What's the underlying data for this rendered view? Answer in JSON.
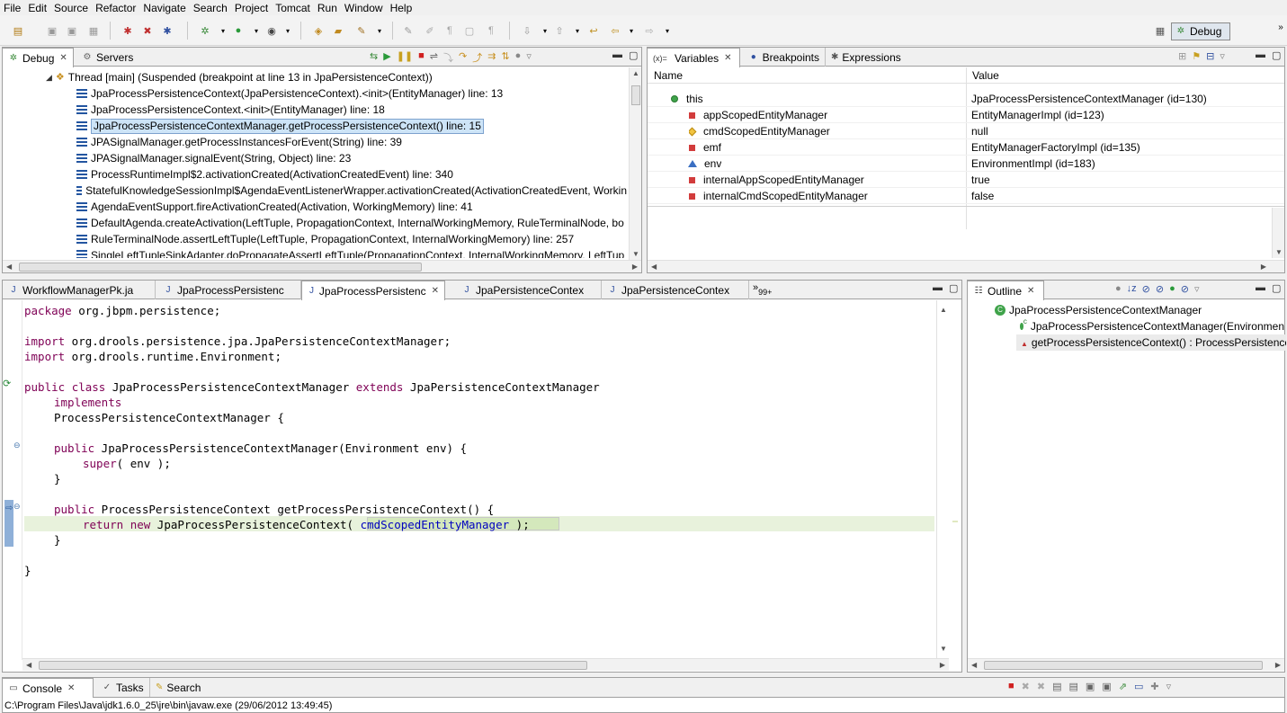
{
  "menu": [
    "File",
    "Edit",
    "Source",
    "Refactor",
    "Navigate",
    "Search",
    "Project",
    "Tomcat",
    "Run",
    "Window",
    "Help"
  ],
  "perspective": {
    "label": "Debug"
  },
  "debug_view": {
    "tabs": [
      {
        "label": "Debug",
        "active": true
      },
      {
        "label": "Servers",
        "active": false
      }
    ],
    "thread": "Thread [main] (Suspended (breakpoint at line 13 in JpaPersistenceContext))",
    "frames": [
      "JpaProcessPersistenceContext(JpaPersistenceContext).<init>(EntityManager) line: 13",
      "JpaProcessPersistenceContext.<init>(EntityManager) line: 18",
      "JpaProcessPersistenceContextManager.getProcessPersistenceContext() line: 15",
      "JPASignalManager.getProcessInstancesForEvent(String) line: 39",
      "JPASignalManager.signalEvent(String, Object) line: 23",
      "ProcessRuntimeImpl$2.activationCreated(ActivationCreatedEvent) line: 340",
      "StatefulKnowledgeSessionImpl$AgendaEventListenerWrapper.activationCreated(ActivationCreatedEvent, Workin",
      "AgendaEventSupport.fireActivationCreated(Activation, WorkingMemory) line: 41",
      "DefaultAgenda.createActivation(LeftTuple, PropagationContext, InternalWorkingMemory, RuleTerminalNode, bo",
      "RuleTerminalNode.assertLeftTuple(LeftTuple, PropagationContext, InternalWorkingMemory) line: 257",
      "SingleLeftTupleSinkAdapter.doPropagateAssertLeftTuple(PropagationContext, InternalWorkingMemory, LeftTup"
    ],
    "selected_frame": 2
  },
  "variables_view": {
    "tabs": [
      {
        "label": "Variables",
        "active": true
      },
      {
        "label": "Breakpoints",
        "active": false
      },
      {
        "label": "Expressions",
        "active": false
      }
    ],
    "columns": [
      "Name",
      "Value"
    ],
    "rows": [
      {
        "name": "this",
        "value": "JpaProcessPersistenceContextManager  (id=130)",
        "icon": "object-icon"
      },
      {
        "name": "appScopedEntityManager",
        "value": "EntityManagerImpl  (id=123)",
        "icon": "private-field-icon"
      },
      {
        "name": "cmdScopedEntityManager",
        "value": "null",
        "icon": "protected-field-icon"
      },
      {
        "name": "emf",
        "value": "EntityManagerFactoryImpl  (id=135)",
        "icon": "private-field-icon"
      },
      {
        "name": "env",
        "value": "EnvironmentImpl  (id=183)",
        "icon": "package-field-icon"
      },
      {
        "name": "internalAppScopedEntityManager",
        "value": "true",
        "icon": "private-field-icon"
      },
      {
        "name": "internalCmdScopedEntityManager",
        "value": "false",
        "icon": "private-field-icon"
      }
    ]
  },
  "editor": {
    "tabs": [
      {
        "label": "WorkflowManagerPk.ja",
        "active": false
      },
      {
        "label": "JpaProcessPersistenc",
        "active": false
      },
      {
        "label": "JpaProcessPersistenc",
        "active": true
      },
      {
        "label": "JpaPersistenceContex",
        "active": false
      },
      {
        "label": "JpaPersistenceContex",
        "active": false
      }
    ],
    "overflow": "99+",
    "code": {
      "l1_kw": "package",
      "l1_rest": " org.jbpm.persistence;",
      "l2_kw": "import",
      "l2_rest": " org.drools.persistence.jpa.JpaPersistenceContextManager;",
      "l3_kw": "import",
      "l3_rest": " org.drools.runtime.Environment;",
      "l4_kw1": "public",
      "l4_kw2": "class",
      "l4_name": " JpaProcessPersistenceContextManager ",
      "l4_kw3": "extends",
      "l4_rest": " JpaPersistenceContextManager",
      "l5_kw": "implements",
      "l6": "ProcessPersistenceContextManager {",
      "l7_kw": "public",
      "l7_rest": " JpaProcessPersistenceContextManager(Environment env) {",
      "l8_kw": "super",
      "l8_rest": "( env );",
      "l9": "}",
      "l10_kw": "public",
      "l10_rest": " ProcessPersistenceContext getProcessPersistenceContext() {",
      "l11_kw1": "return",
      "l11_kw2": "new",
      "l11_mid": " JpaProcessPersistenceContext( ",
      "l11_fld": "cmdScopedEntityManager",
      "l11_end": " );",
      "l12": "}",
      "l13": "}"
    }
  },
  "outline": {
    "tab": "Outline",
    "items": [
      "JpaProcessPersistenceContextManager",
      "JpaProcessPersistenceContextManager(Environmen",
      "getProcessPersistenceContext() : ProcessPersistence"
    ],
    "constructor_badge": "c"
  },
  "console": {
    "tabs": [
      {
        "label": "Console",
        "active": true
      },
      {
        "label": "Tasks",
        "active": false
      },
      {
        "label": "Search",
        "active": false
      }
    ],
    "status": "C:\\Program Files\\Java\\jdk1.6.0_25\\jre\\bin\\javaw.exe (29/06/2012 13:49:45)"
  }
}
